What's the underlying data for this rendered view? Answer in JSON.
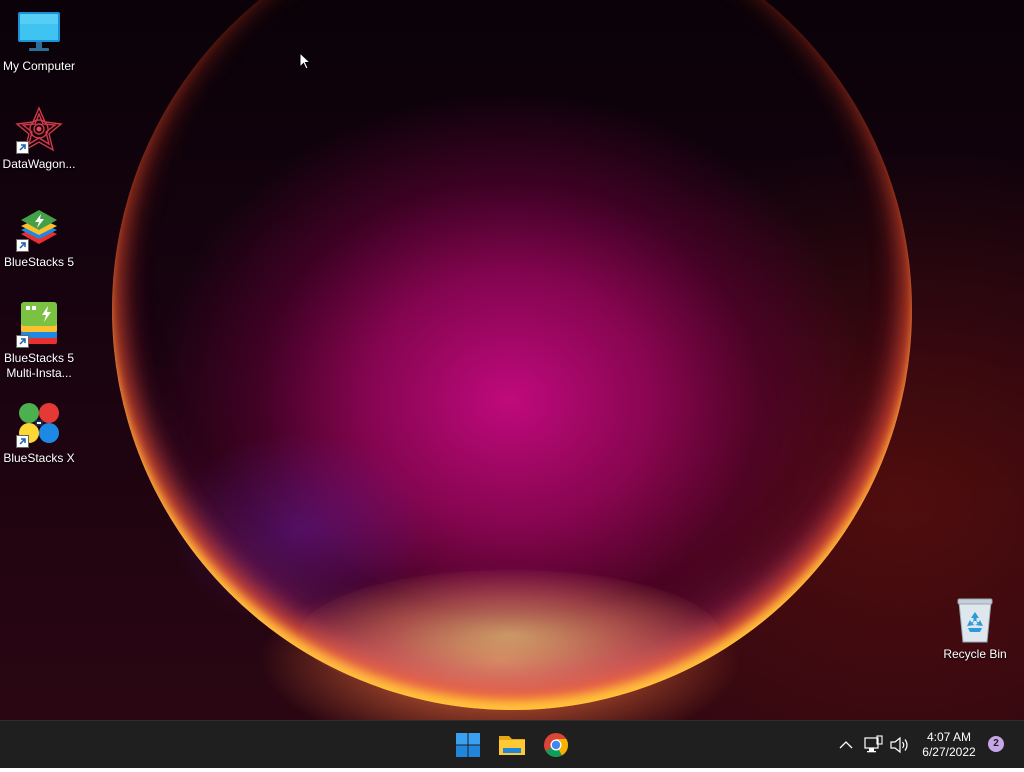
{
  "desktop": {
    "icons": [
      {
        "label": "My Computer",
        "icon": "monitor-icon",
        "shortcut": false
      },
      {
        "label": "DataWagon...",
        "icon": "datawagon-icon",
        "shortcut": true
      },
      {
        "label": "BlueStacks 5",
        "icon": "bluestacks-icon",
        "shortcut": true
      },
      {
        "label": "BlueStacks 5 Multi-Insta...",
        "label_line1": "BlueStacks 5",
        "label_line2": "Multi-Insta...",
        "icon": "bluestacks-multi-icon",
        "shortcut": true
      },
      {
        "label": "BlueStacks X",
        "icon": "bluestacks-x-icon",
        "shortcut": true
      }
    ],
    "recycle_bin": {
      "label": "Recycle Bin",
      "icon": "recycle-bin-icon"
    }
  },
  "taskbar": {
    "buttons": [
      {
        "name": "start-button",
        "icon": "windows-logo-icon"
      },
      {
        "name": "file-explorer-button",
        "icon": "folder-icon"
      },
      {
        "name": "chrome-button",
        "icon": "chrome-icon"
      }
    ],
    "tray": {
      "overflow_icon": "chevron-up-icon",
      "network_icon": "network-icon",
      "volume_icon": "speaker-icon"
    },
    "clock": {
      "time": "4:07 AM",
      "date": "6/27/2022"
    },
    "notifications": {
      "count": "2"
    }
  },
  "colors": {
    "taskbar_bg": "#1f1f1f",
    "accent": "#0078d4",
    "badge": "#c7a6e6"
  }
}
